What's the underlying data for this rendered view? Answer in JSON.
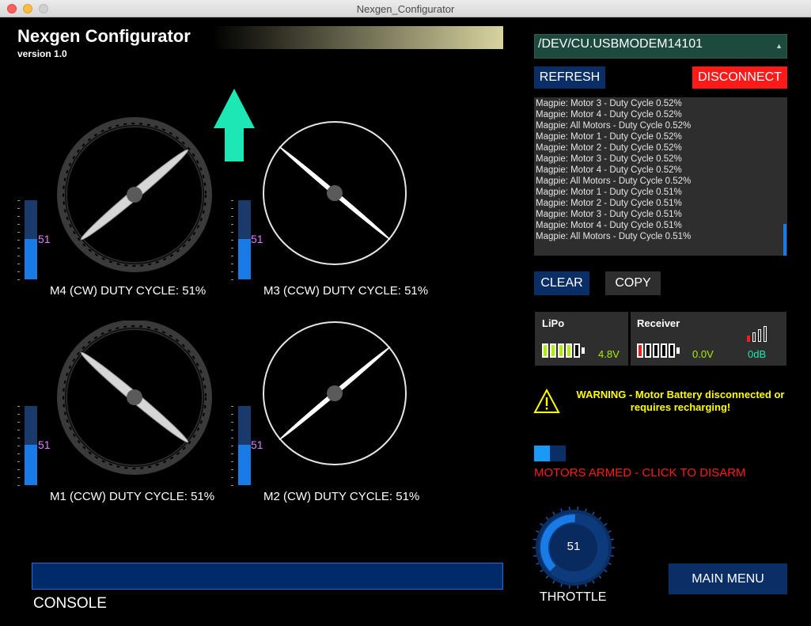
{
  "window": {
    "title": "Nexgen_Configurator"
  },
  "header": {
    "title": "Nexgen Configurator",
    "version": "version 1.0"
  },
  "motors": [
    {
      "label": "M4 (CW) DUTY CYCLE: 51%",
      "duty": 51
    },
    {
      "label": "M3 (CCW) DUTY CYCLE: 51%",
      "duty": 51
    },
    {
      "label": "M1 (CCW) DUTY CYCLE: 51%",
      "duty": 51
    },
    {
      "label": "M2 (CW) DUTY CYCLE: 51%",
      "duty": 51
    }
  ],
  "console": {
    "label": "CONSOLE"
  },
  "serial": {
    "port": "/DEV/CU.USBMODEM14101",
    "refresh_label": "REFRESH",
    "disconnect_label": "DISCONNECT"
  },
  "log": [
    "Magpie: Motor 3 - Duty Cycle 0.52%",
    "Magpie: Motor 4 - Duty Cycle 0.52%",
    "Magpie: All Motors - Duty Cycle 0.52%",
    "Magpie: Motor 1 - Duty Cycle 0.52%",
    "Magpie: Motor 2 - Duty Cycle 0.52%",
    "Magpie: Motor 3 - Duty Cycle 0.52%",
    "Magpie: Motor 4 - Duty Cycle 0.52%",
    "Magpie: All Motors - Duty Cycle 0.52%",
    "Magpie: Motor 1 - Duty Cycle 0.51%",
    "Magpie: Motor 2 - Duty Cycle 0.51%",
    "Magpie: Motor 3 - Duty Cycle 0.51%",
    "Magpie: Motor 4 - Duty Cycle 0.51%",
    "Magpie: All Motors - Duty Cycle 0.51%"
  ],
  "log_controls": {
    "clear_label": "CLEAR",
    "copy_label": "COPY"
  },
  "lipo": {
    "title": "LiPo",
    "voltage": "4.8V",
    "cells_filled": 4,
    "cells_total": 5
  },
  "receiver": {
    "title": "Receiver",
    "voltage": "0.0V",
    "signal": "0dB",
    "cells_filled": 1,
    "cells_total": 5,
    "signal_bars_filled": 1,
    "signal_bars_total": 4
  },
  "warning": {
    "line1": "WARNING - Motor Battery disconnected or",
    "line2": "requires recharging!"
  },
  "arm": {
    "label": "MOTORS ARMED - CLICK TO DISARM",
    "armed": true
  },
  "throttle": {
    "label": "THROTTLE",
    "value": 51
  },
  "navigation": {
    "main_menu_label": "MAIN MENU"
  },
  "colors": {
    "accent_blue": "#1a7ae6",
    "button_blue": "#0a2e66",
    "disconnect_red": "#ff1a1a",
    "arrow_green": "#1de8b5",
    "warning_yellow": "#ffff00",
    "lipo_green": "#aaf000",
    "receiver_red": "#ff1a1a",
    "duty_value_pink": "#e080ff"
  }
}
